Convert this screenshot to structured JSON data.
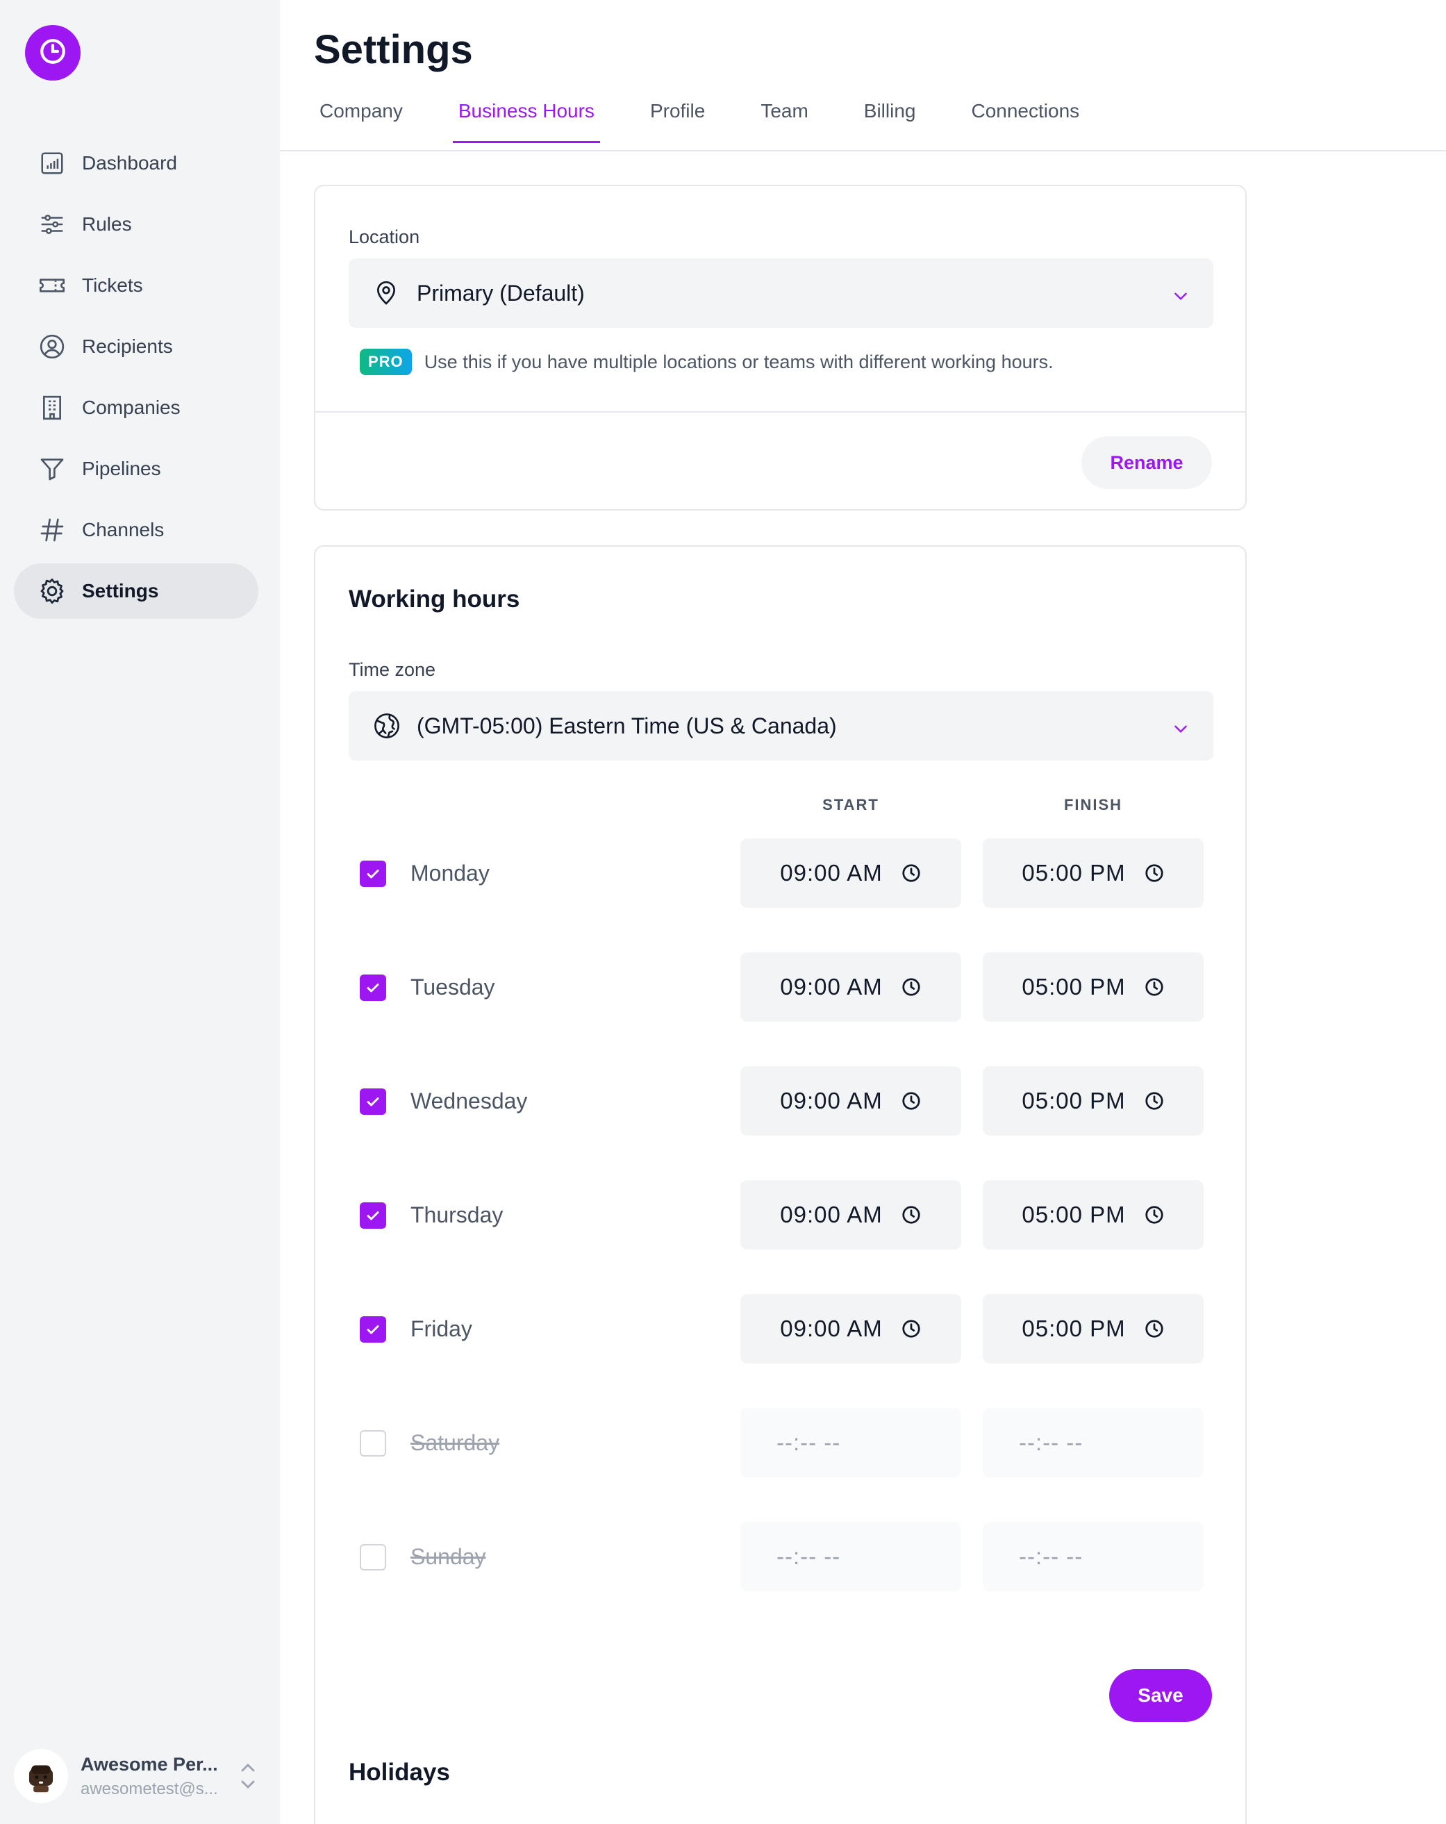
{
  "app": {
    "accent_color": "#9d17f2",
    "logo_icon": "clock-icon"
  },
  "sidebar": {
    "items": [
      {
        "label": "Dashboard",
        "icon": "bar-chart-icon",
        "active": false
      },
      {
        "label": "Rules",
        "icon": "sliders-icon",
        "active": false
      },
      {
        "label": "Tickets",
        "icon": "ticket-icon",
        "active": false
      },
      {
        "label": "Recipients",
        "icon": "user-circle-icon",
        "active": false
      },
      {
        "label": "Companies",
        "icon": "building-icon",
        "active": false
      },
      {
        "label": "Pipelines",
        "icon": "funnel-icon",
        "active": false
      },
      {
        "label": "Channels",
        "icon": "hashtag-icon",
        "active": false
      },
      {
        "label": "Settings",
        "icon": "gear-icon",
        "active": true
      }
    ],
    "user": {
      "name": "Awesome Per...",
      "email": "awesometest@s..."
    }
  },
  "header": {
    "title": "Settings",
    "tabs": [
      {
        "label": "Company",
        "active": false
      },
      {
        "label": "Business Hours",
        "active": true
      },
      {
        "label": "Profile",
        "active": false
      },
      {
        "label": "Team",
        "active": false
      },
      {
        "label": "Billing",
        "active": false
      },
      {
        "label": "Connections",
        "active": false
      }
    ]
  },
  "location": {
    "label": "Location",
    "selected": "Primary (Default)",
    "pro_badge": "PRO",
    "pro_text": "Use this if you have multiple locations or teams with different working hours.",
    "rename_label": "Rename"
  },
  "working_hours": {
    "title": "Working hours",
    "timezone_label": "Time zone",
    "timezone": "(GMT-05:00) Eastern Time (US & Canada)",
    "start_header": "START",
    "finish_header": "FINISH",
    "days": [
      {
        "name": "Monday",
        "enabled": true,
        "start": "09:00 AM",
        "finish": "05:00 PM"
      },
      {
        "name": "Tuesday",
        "enabled": true,
        "start": "09:00 AM",
        "finish": "05:00 PM"
      },
      {
        "name": "Wednesday",
        "enabled": true,
        "start": "09:00 AM",
        "finish": "05:00 PM"
      },
      {
        "name": "Thursday",
        "enabled": true,
        "start": "09:00 AM",
        "finish": "05:00 PM"
      },
      {
        "name": "Friday",
        "enabled": true,
        "start": "09:00 AM",
        "finish": "05:00 PM"
      },
      {
        "name": "Saturday",
        "enabled": false,
        "start": "--:-- --",
        "finish": "--:-- --"
      },
      {
        "name": "Sunday",
        "enabled": false,
        "start": "--:-- --",
        "finish": "--:-- --"
      }
    ],
    "save_label": "Save"
  },
  "holidays": {
    "title": "Holidays"
  }
}
